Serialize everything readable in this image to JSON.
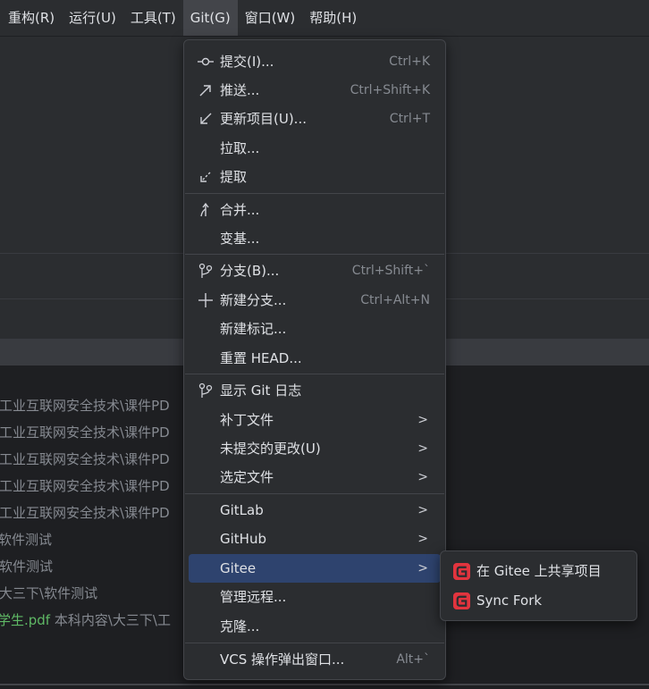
{
  "menubar": [
    {
      "label": "重构(R)",
      "active": false
    },
    {
      "label": "运行(U)",
      "active": false
    },
    {
      "label": "工具(T)",
      "active": false
    },
    {
      "label": "Git(G)",
      "active": true
    },
    {
      "label": "窗口(W)",
      "active": false
    },
    {
      "label": "帮助(H)",
      "active": false
    }
  ],
  "background_lines": [
    "\\工业互联网安全技术\\课件PD",
    "\\工业互联网安全技术\\课件PD",
    "\\工业互联网安全技术\\课件PD",
    "\\工业互联网安全技术\\课件PD",
    "\\工业互联网安全技术\\课件PD",
    "软件测试",
    "\\软件测试",
    "\\大三下\\软件测试"
  ],
  "background_pdf": {
    "name": "学生.pdf",
    "path": "本科内容\\大三下\\工"
  },
  "git_menu": {
    "items": [
      {
        "label": "提交(I)...",
        "shortcut": "Ctrl+K",
        "icon": "commit-icon"
      },
      {
        "label": "推送...",
        "shortcut": "Ctrl+Shift+K",
        "icon": "push-arrow-icon"
      },
      {
        "label": "更新项目(U)...",
        "shortcut": "Ctrl+T",
        "icon": "update-arrow-icon"
      },
      {
        "label": "拉取...",
        "shortcut": "",
        "icon": ""
      },
      {
        "label": "提取",
        "shortcut": "",
        "icon": "fetch-icon"
      },
      {
        "label": "合并...",
        "shortcut": "",
        "icon": "merge-icon"
      },
      {
        "label": "变基...",
        "shortcut": "",
        "icon": ""
      },
      {
        "label": "分支(B)...",
        "shortcut": "Ctrl+Shift+`",
        "icon": "branch-icon"
      },
      {
        "label": "新建分支...",
        "shortcut": "Ctrl+Alt+N",
        "icon": "plus-icon"
      },
      {
        "label": "新建标记...",
        "shortcut": "",
        "icon": ""
      },
      {
        "label": "重置 HEAD...",
        "shortcut": "",
        "icon": ""
      },
      {
        "label": "显示 Git 日志",
        "shortcut": "",
        "icon": "git-log-icon"
      },
      {
        "label": "补丁文件",
        "shortcut": "",
        "icon": ""
      },
      {
        "label": "未提交的更改(U)",
        "shortcut": "",
        "icon": ""
      },
      {
        "label": "选定文件",
        "shortcut": "",
        "icon": ""
      },
      {
        "label": "GitLab",
        "shortcut": "",
        "icon": ""
      },
      {
        "label": "GitHub",
        "shortcut": "",
        "icon": ""
      },
      {
        "label": "Gitee",
        "shortcut": "",
        "icon": ""
      },
      {
        "label": "管理远程...",
        "shortcut": "",
        "icon": ""
      },
      {
        "label": "克隆...",
        "shortcut": "",
        "icon": ""
      },
      {
        "label": "VCS 操作弹出窗口...",
        "shortcut": "Alt+`",
        "icon": ""
      }
    ],
    "highlighted": "Gitee"
  },
  "gitee_submenu": [
    {
      "label": "在 Gitee 上共享项目",
      "icon": "gitee-logo-icon"
    },
    {
      "label": "Sync Fork",
      "icon": "gitee-logo-icon"
    }
  ],
  "colors": {
    "accent_highlight": "#2e436e",
    "gitee_red": "#e2343e",
    "menu_bg": "#2b2d30"
  }
}
